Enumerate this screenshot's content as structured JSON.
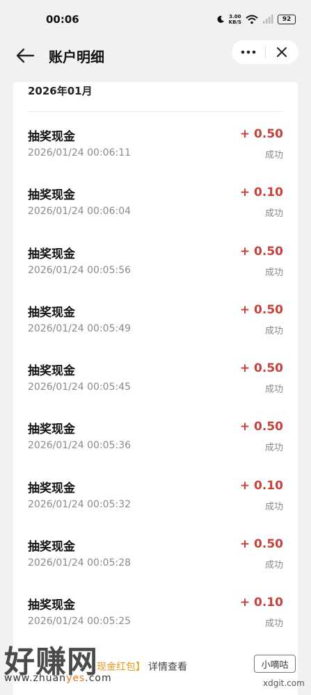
{
  "status_bar": {
    "time": "00:06",
    "net_speed": "3.00",
    "net_unit": "KB/S",
    "battery": "92"
  },
  "header": {
    "title": "账户明细"
  },
  "list": {
    "month": "2026年01月",
    "records": [
      {
        "title": "抽奖现金",
        "time": "2026/01/24 00:06:11",
        "amount": "+ 0.50",
        "status": "成功"
      },
      {
        "title": "抽奖现金",
        "time": "2026/01/24 00:06:04",
        "amount": "+ 0.10",
        "status": "成功"
      },
      {
        "title": "抽奖现金",
        "time": "2026/01/24 00:05:56",
        "amount": "+ 0.50",
        "status": "成功"
      },
      {
        "title": "抽奖现金",
        "time": "2026/01/24 00:05:49",
        "amount": "+ 0.50",
        "status": "成功"
      },
      {
        "title": "抽奖现金",
        "time": "2026/01/24 00:05:45",
        "amount": "+ 0.50",
        "status": "成功"
      },
      {
        "title": "抽奖现金",
        "time": "2026/01/24 00:05:36",
        "amount": "+ 0.50",
        "status": "成功"
      },
      {
        "title": "抽奖现金",
        "time": "2026/01/24 00:05:32",
        "amount": "+ 0.10",
        "status": "成功"
      },
      {
        "title": "抽奖现金",
        "time": "2026/01/24 00:05:28",
        "amount": "+ 0.50",
        "status": "成功"
      },
      {
        "title": "抽奖现金",
        "time": "2026/01/24 00:05:25",
        "amount": "+ 0.10",
        "status": "成功"
      }
    ]
  },
  "banner": {
    "highlight": "现金红包】",
    "link": "详情查看"
  },
  "watermark": {
    "left_logo": "好赚网",
    "url_prefix": "www.zhuan",
    "url_mid": "yes",
    "url_suffix": ".com",
    "right_logo": "小嘀咕",
    "right_top": "",
    "right_url": "xdgit.com"
  },
  "colors": {
    "amount": "#c8403a",
    "highlight": "#e69a1a",
    "background": "#f1f1f1"
  }
}
